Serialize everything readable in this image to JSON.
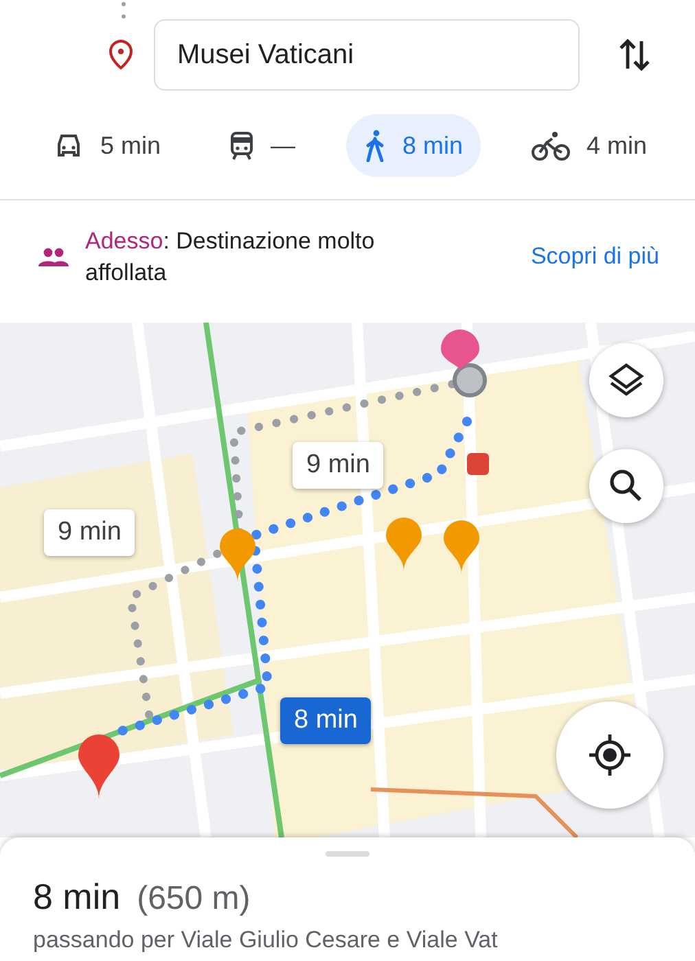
{
  "destination": {
    "value": "Musei Vaticani"
  },
  "modes": [
    {
      "kind": "car",
      "label": "5 min",
      "selected": false
    },
    {
      "kind": "transit",
      "label": "—",
      "selected": false
    },
    {
      "kind": "walk",
      "label": "8 min",
      "selected": true
    },
    {
      "kind": "bike",
      "label": "4 min",
      "selected": false
    }
  ],
  "crowd": {
    "status": "Adesso",
    "text": ": Destinazione molto affollata",
    "link": "Scopri di più"
  },
  "map": {
    "kind": "picture",
    "route_labels": [
      {
        "label": "9 min",
        "selected": false
      },
      {
        "label": "9 min",
        "selected": false
      },
      {
        "label": "8 min",
        "selected": true
      }
    ]
  },
  "summary": {
    "duration": "8 min",
    "distance": "(650 m)",
    "via": "passando per Viale Giulio Cesare e Viale Vat"
  }
}
